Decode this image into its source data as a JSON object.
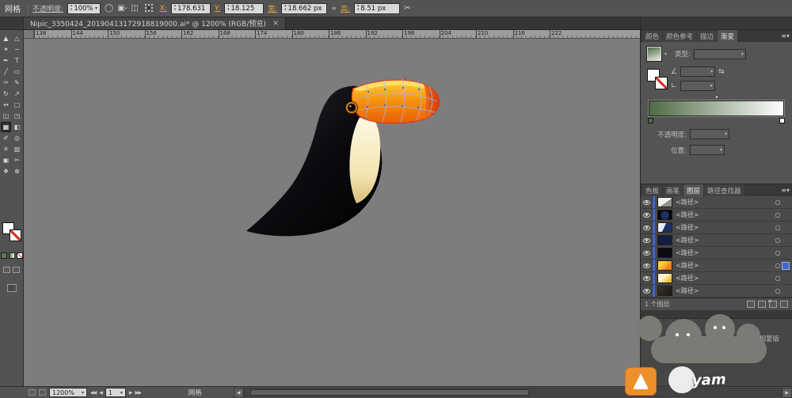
{
  "control_bar": {
    "left_label": "网格",
    "opacity_label": "不透明度:",
    "opacity_value": "100%",
    "x_label": "X:",
    "x_value": "178.631",
    "y_label": "Y:",
    "y_value": "18.125",
    "width_label": "宽:",
    "width_value": "18.662 px",
    "height_label": "高:",
    "height_value": "8.51 px"
  },
  "document_tab": {
    "title": "Nipic_3350424_20190413172918819000.ai* @ 1200% (RGB/预览)",
    "close_glyph": "×"
  },
  "ruler_marks": [
    "138",
    "144",
    "150",
    "156",
    "162",
    "168",
    "174",
    "180",
    "186",
    "192",
    "198",
    "204",
    "210",
    "216",
    "222"
  ],
  "tools": [
    {
      "name": "selection-tool",
      "glyph": "▲",
      "cls": ""
    },
    {
      "name": "direct-selection-tool",
      "glyph": "△",
      "cls": ""
    },
    {
      "name": "magic-wand-tool",
      "glyph": "✶",
      "cls": ""
    },
    {
      "name": "lasso-tool",
      "glyph": "∽",
      "cls": ""
    },
    {
      "name": "pen-tool",
      "glyph": "✒",
      "cls": ""
    },
    {
      "name": "type-tool",
      "glyph": "T",
      "cls": ""
    },
    {
      "name": "line-segment-tool",
      "glyph": "╱",
      "cls": ""
    },
    {
      "name": "rectangle-tool",
      "glyph": "▭",
      "cls": ""
    },
    {
      "name": "paintbrush-tool",
      "glyph": "✑",
      "cls": ""
    },
    {
      "name": "pencil-tool",
      "glyph": "✎",
      "cls": ""
    },
    {
      "name": "rotate-tool",
      "glyph": "↻",
      "cls": ""
    },
    {
      "name": "scale-tool",
      "glyph": "↗",
      "cls": ""
    },
    {
      "name": "width-tool",
      "glyph": "↔",
      "cls": ""
    },
    {
      "name": "free-transform-tool",
      "glyph": "▢",
      "cls": ""
    },
    {
      "name": "shape-builder-tool",
      "glyph": "◱",
      "cls": ""
    },
    {
      "name": "perspective-grid-tool",
      "glyph": "◳",
      "cls": ""
    },
    {
      "name": "mesh-tool",
      "glyph": "▦",
      "cls": "active"
    },
    {
      "name": "gradient-tool",
      "glyph": "◧",
      "cls": ""
    },
    {
      "name": "eyedropper-tool",
      "glyph": "✐",
      "cls": ""
    },
    {
      "name": "blend-tool",
      "glyph": "◎",
      "cls": ""
    },
    {
      "name": "symbol-sprayer-tool",
      "glyph": "✳",
      "cls": ""
    },
    {
      "name": "column-graph-tool",
      "glyph": "▥",
      "cls": ""
    },
    {
      "name": "artboard-tool",
      "glyph": "▣",
      "cls": ""
    },
    {
      "name": "slice-tool",
      "glyph": "✂",
      "cls": ""
    },
    {
      "name": "hand-tool",
      "glyph": "❖",
      "cls": ""
    },
    {
      "name": "zoom-tool",
      "glyph": "⊕",
      "cls": ""
    }
  ],
  "gradient_panel": {
    "tabs": [
      {
        "label": "颜色",
        "cls": ""
      },
      {
        "label": "颜色参考",
        "cls": ""
      },
      {
        "label": "描边",
        "cls": ""
      },
      {
        "label": "渐变",
        "cls": "active"
      }
    ],
    "type_label": "类型:",
    "opacity_label": "不透明度:",
    "location_label": "位置:",
    "gradient_start_color": "#4f6b45",
    "gradient_end_color": "#ffffff"
  },
  "layers_panel": {
    "tabs": [
      {
        "label": "色板",
        "cls": ""
      },
      {
        "label": "画笔",
        "cls": ""
      },
      {
        "label": "图层",
        "cls": "active"
      },
      {
        "label": "路径查找器",
        "cls": ""
      }
    ],
    "rows": [
      {
        "label": "<路径>",
        "thumb": "t1",
        "sel": ""
      },
      {
        "label": "<路径>",
        "thumb": "t2",
        "sel": ""
      },
      {
        "label": "<路径>",
        "thumb": "t3",
        "sel": ""
      },
      {
        "label": "<路径>",
        "thumb": "t4",
        "sel": ""
      },
      {
        "label": "<路径>",
        "thumb": "t5",
        "sel": ""
      },
      {
        "label": "<路径>",
        "thumb": "t6",
        "sel": "selected"
      },
      {
        "label": "<路径>",
        "thumb": "t7",
        "sel": ""
      },
      {
        "label": "<路径>",
        "thumb": "t8",
        "sel": ""
      }
    ],
    "footer_label": "1 个图层"
  },
  "transparency_panel": {
    "invert_mask_label": "反相蒙版"
  },
  "status_bar": {
    "zoom": "1200%",
    "artboard_number": "1",
    "tool_name": "网格"
  },
  "watermark": {
    "text": "yam"
  },
  "canvas": {
    "background_color": "#7d7d7d"
  },
  "accent_colors": {
    "selection_blue": "#3e68cc",
    "mesh_outline_red": "#e0301e",
    "beak_orange": "#f79410"
  }
}
